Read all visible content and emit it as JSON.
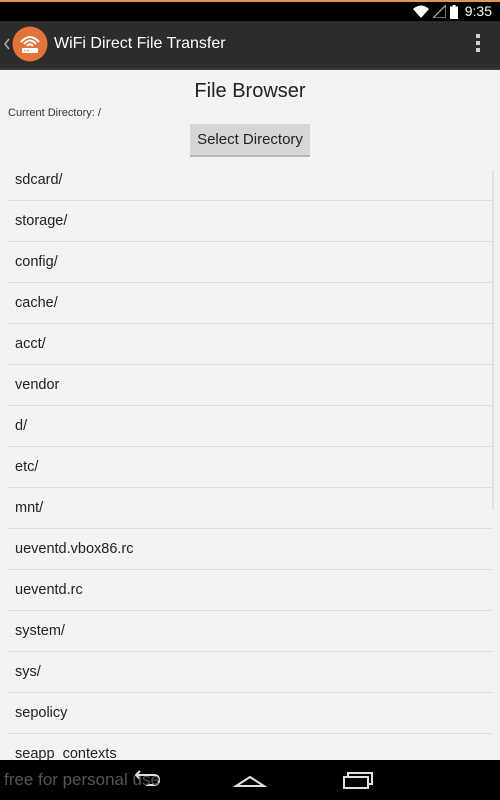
{
  "status_bar": {
    "time": "9:35",
    "accent": "#e8914a",
    "icons": [
      "wifi-icon",
      "signal-icon",
      "battery-icon"
    ]
  },
  "action_bar": {
    "title": "WiFi Direct File Transfer",
    "app_icon": "wifi-router-icon",
    "overflow_icon": "overflow-menu-icon"
  },
  "page": {
    "title": "File Browser",
    "current_directory": "Current Directory: /",
    "select_button": "Select Directory"
  },
  "files": [
    "sdcard/",
    "storage/",
    "config/",
    "cache/",
    "acct/",
    "vendor",
    "d/",
    "etc/",
    "mnt/",
    "ueventd.vbox86.rc",
    "ueventd.rc",
    "system/",
    "sys/",
    "sepolicy",
    "seapp_contexts"
  ],
  "nav_bar": {
    "icons": [
      "back-icon",
      "home-icon",
      "recents-icon"
    ]
  },
  "watermark": "free for personal use"
}
